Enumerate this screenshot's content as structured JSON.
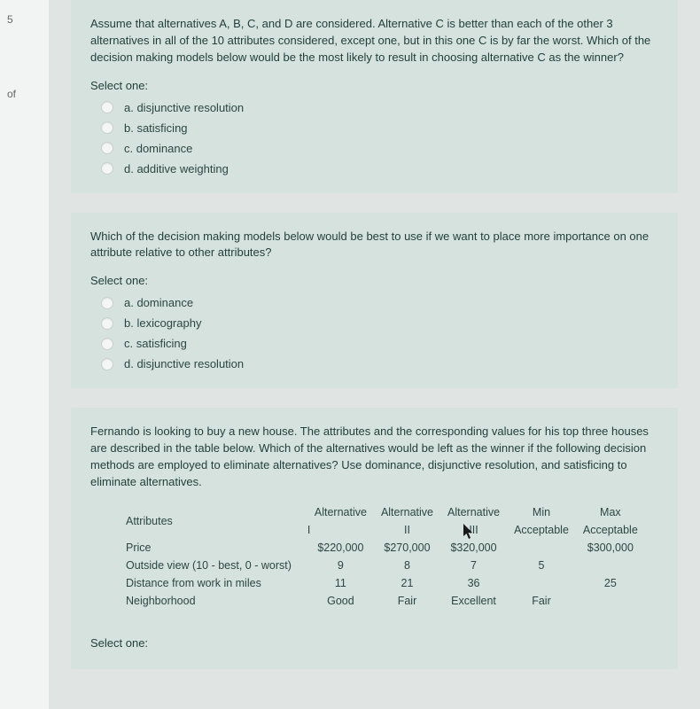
{
  "sidebar": {
    "label1": "5",
    "label2": "of"
  },
  "questions": [
    {
      "text": "Assume that alternatives A, B, C, and D are considered. Alternative C is better than each of the other 3 alternatives in all of the 10 attributes considered, except one, but in this one C is by far the worst. Which of the decision making models below would be the most likely to result in choosing alternative C as the winner?",
      "select": "Select one:",
      "options": [
        "a. disjunctive resolution",
        "b. satisficing",
        "c. dominance",
        "d. additive weighting"
      ]
    },
    {
      "text": "Which of the decision making models below would be best to use if we want to place more importance on one attribute relative to other attributes?",
      "select": "Select one:",
      "options": [
        "a. dominance",
        "b. lexicography",
        "c. satisficing",
        "d. disjunctive resolution"
      ]
    },
    {
      "text": "Fernando is looking to buy a new house. The attributes and the corresponding values for his top three houses are described in the table below. Which of the alternatives would be left as the winner if the following decision methods are employed to eliminate alternatives? Use dominance, disjunctive resolution, and satisficing to eliminate alternatives.",
      "select": "Select one:"
    }
  ],
  "table": {
    "headers": {
      "attr": "Attributes",
      "alt1_top": "Alternative",
      "alt1_sub": "I",
      "alt2_top": "Alternative",
      "alt2_sub": "II",
      "alt3_top": "Alternative",
      "alt3_sub": "III",
      "min_top": "Min",
      "min_sub": "Acceptable",
      "max_top": "Max",
      "max_sub": "Acceptable"
    },
    "rows": [
      {
        "attr": "Price",
        "a1": "$220,000",
        "a2": "$270,000",
        "a3": "$320,000",
        "min": "",
        "max": "$300,000"
      },
      {
        "attr": "Outside view (10 - best, 0 - worst)",
        "a1": "9",
        "a2": "8",
        "a3": "7",
        "min": "5",
        "max": ""
      },
      {
        "attr": "Distance from work in miles",
        "a1": "11",
        "a2": "21",
        "a3": "36",
        "min": "",
        "max": "25"
      },
      {
        "attr": "Neighborhood",
        "a1": "Good",
        "a2": "Fair",
        "a3": "Excellent",
        "min": "Fair",
        "max": ""
      }
    ]
  }
}
